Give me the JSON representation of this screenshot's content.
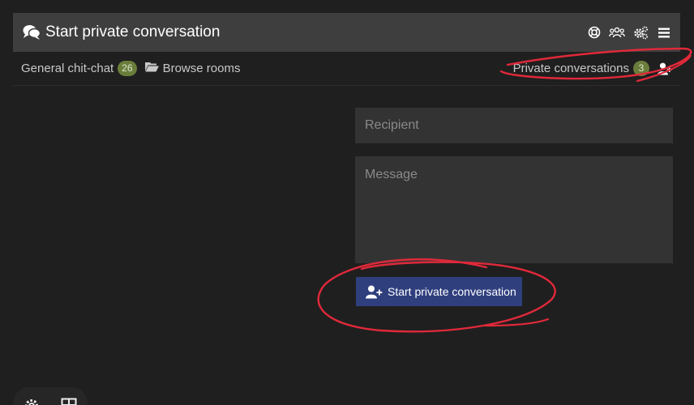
{
  "header": {
    "title": "Start private conversation",
    "icons": [
      "help-ring-icon",
      "users-icon",
      "settings-gears-icon",
      "menu-icon"
    ]
  },
  "subnav": {
    "general_chat": {
      "label": "General chit-chat",
      "count": "26"
    },
    "browse_rooms": {
      "label": "Browse rooms",
      "icon": "folder-open-icon"
    },
    "private_conversations": {
      "label": "Private conversations",
      "count": "3",
      "icon": "user-plus-icon"
    }
  },
  "form": {
    "recipient": {
      "placeholder": "Recipient",
      "value": ""
    },
    "message": {
      "placeholder": "Message",
      "value": ""
    },
    "submit_label": "Start private conversation"
  },
  "dock": {
    "icons": [
      "settings-icon",
      "layout-icon"
    ]
  },
  "colors": {
    "background": "#1f1f1f",
    "header": "#3e3e3e",
    "input": "#333333",
    "button": "#2f3f7e",
    "badge": "#6a7d3b",
    "annotation": "#e0293a"
  }
}
